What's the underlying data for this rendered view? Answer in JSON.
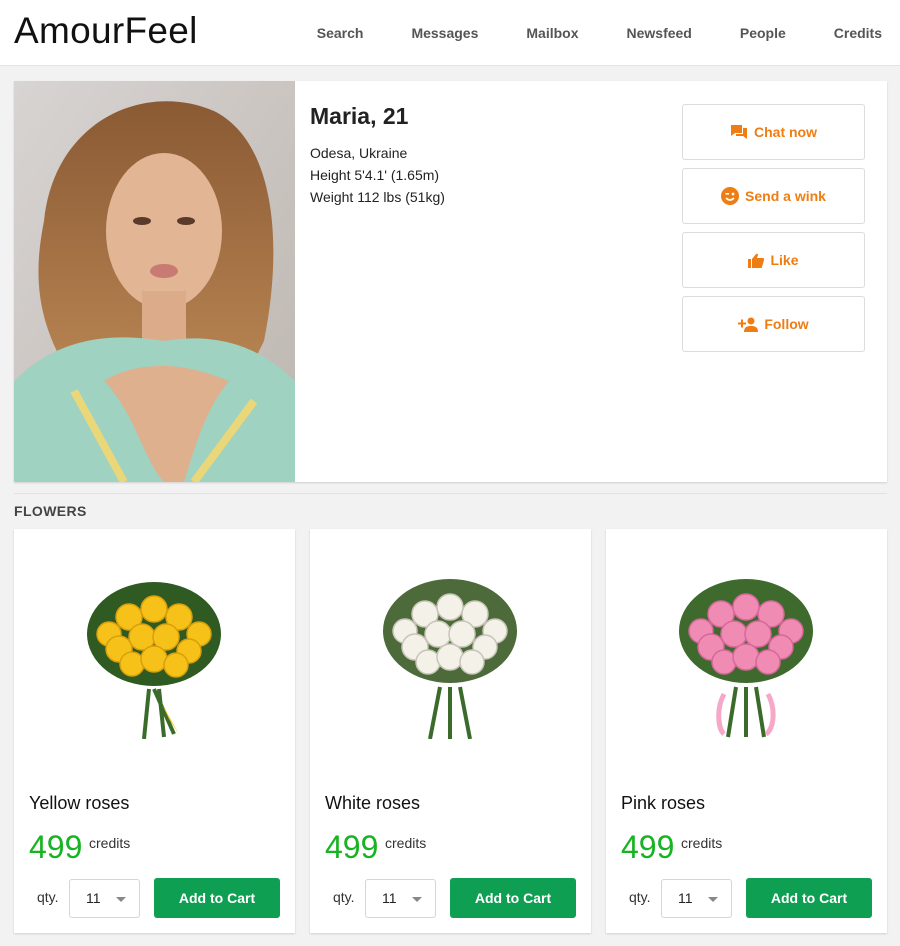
{
  "header": {
    "logo": "AmourFeel",
    "nav": [
      "Search",
      "Messages",
      "Mailbox",
      "Newsfeed",
      "People",
      "Credits"
    ]
  },
  "profile": {
    "name": "Maria, 21",
    "location": "Odesa, Ukraine",
    "height": "Height 5'4.1' (1.65m)",
    "weight": "Weight 112 lbs (51kg)",
    "actions": [
      {
        "label": "Chat now",
        "icon": "chat-icon"
      },
      {
        "label": "Send a wink",
        "icon": "wink-icon"
      },
      {
        "label": "Like",
        "icon": "thumbs-up-icon"
      },
      {
        "label": "Follow",
        "icon": "add-person-icon"
      }
    ]
  },
  "section_title": "FLOWERS",
  "products": [
    {
      "name": "Yellow roses",
      "price": "499",
      "unit": "credits",
      "qty_label": "qty.",
      "qty": "11",
      "button": "Add to Cart",
      "color": "#f6c21a"
    },
    {
      "name": "White roses",
      "price": "499",
      "unit": "credits",
      "qty_label": "qty.",
      "qty": "11",
      "button": "Add to Cart",
      "color": "#f3f1e8"
    },
    {
      "name": "Pink roses",
      "price": "499",
      "unit": "credits",
      "qty_label": "qty.",
      "qty": "11",
      "button": "Add to Cart",
      "color": "#f08bb4"
    }
  ],
  "colors": {
    "accent": "#ee7d13",
    "price": "#17b322",
    "cart_button": "#0f9f53"
  }
}
